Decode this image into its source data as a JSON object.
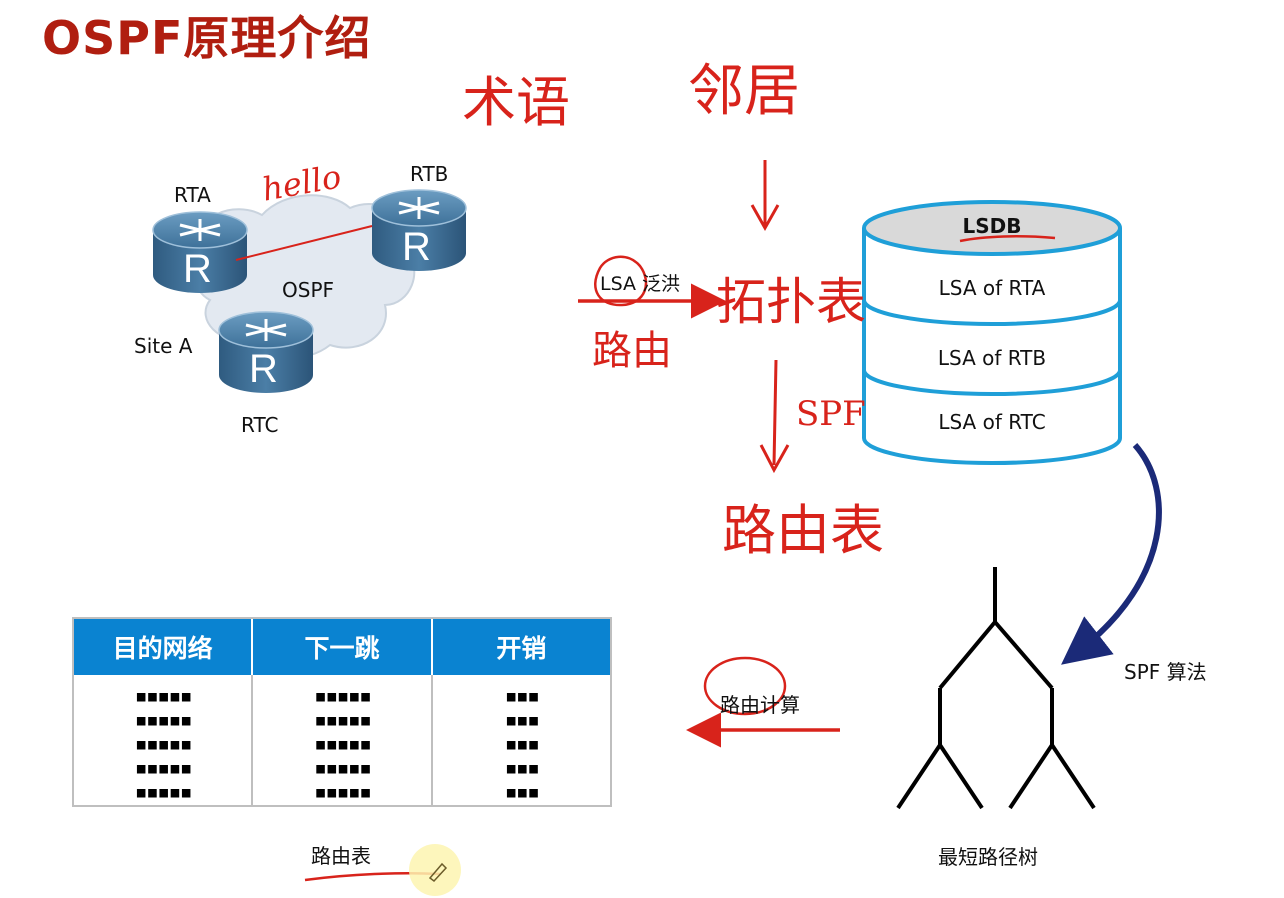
{
  "title": "OSPF原理介绍",
  "network": {
    "routers": [
      {
        "name": "RTA",
        "glyph": "R"
      },
      {
        "name": "RTB",
        "glyph": "R"
      },
      {
        "name": "RTC",
        "glyph": "R"
      }
    ],
    "cloud_label": "OSPF",
    "site_label": "Site A"
  },
  "lsdb": {
    "title": "LSDB",
    "rows": [
      "LSA of RTA",
      "LSA of RTB",
      "LSA of RTC"
    ]
  },
  "flow": {
    "lsa_flood_label": "LSA 泛洪",
    "spf_label": "SPF 算法",
    "route_calc_label": "路由计算"
  },
  "tree_label": "最短路径树",
  "routing_table": {
    "headers": [
      "目的网络",
      "下一跳",
      "开销"
    ],
    "columns": [
      [
        "▪▪▪▪▪",
        "▪▪▪▪▪",
        "▪▪▪▪▪",
        "▪▪▪▪▪",
        "▪▪▪▪▪"
      ],
      [
        "▪▪▪▪▪",
        "▪▪▪▪▪",
        "▪▪▪▪▪",
        "▪▪▪▪▪",
        "▪▪▪▪▪"
      ],
      [
        "▪▪▪",
        "▪▪▪",
        "▪▪▪",
        "▪▪▪",
        "▪▪▪"
      ]
    ],
    "caption": "路由表"
  },
  "annotations": {
    "top_left": "术语",
    "top_right": "邻居",
    "hello": "hello",
    "topo_table": "拓扑表",
    "route": "路由",
    "spf": "SPF",
    "route_table": "路由表"
  },
  "colors": {
    "title": "#b01e10",
    "router": "#3d6f95",
    "cylinder": "#1f9fd8",
    "table_header": "#0a83d1",
    "annotation": "#d8231b",
    "spf_arrow": "#1b2a78"
  }
}
